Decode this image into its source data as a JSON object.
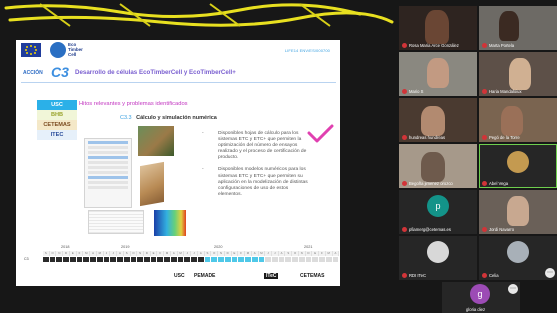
{
  "slide": {
    "top_label": "LIFE14 ENV/ES/000700",
    "logo_text": [
      "Eco",
      "Timber",
      "Cell"
    ],
    "action_word": "ACCIÓN",
    "action_code": "C3",
    "action_title": "Desarrollo de células EcoTimberCell y EcoTimberCell+",
    "partners": [
      "USC",
      "BHB",
      "CETEMAS",
      "ITEC"
    ],
    "hitos_title": "Hitos relevantes y problemas identificados",
    "sub_number": "C3.3",
    "sub_title": "Cálculo y simulación numérica",
    "bullets": [
      "Disponibles hojas de cálculo para los sistemas ETC y ETC+ que permiten la optimización del número de ensayos realizado y el proceso de certificación de producto.",
      "Disponibles modelos numéricos para los sistemas ETC y ETC+ que permiten su aplicación en la modelización de distintas configuraciones de uso de estos elementos."
    ],
    "bullet_dash": "-",
    "timeline": {
      "years": [
        "2018",
        "2019",
        "2020",
        "2021"
      ],
      "months": [
        "S",
        "O",
        "N",
        "D",
        "E",
        "F",
        "M",
        "A",
        "M",
        "J",
        "J",
        "A",
        "S",
        "O",
        "N",
        "D",
        "E",
        "F",
        "M",
        "A",
        "M",
        "J",
        "J",
        "A",
        "S",
        "O",
        "N",
        "D",
        "E",
        "F",
        "M",
        "A",
        "M",
        "J",
        "J",
        "A",
        "S",
        "O",
        "N",
        "D",
        "E",
        "F",
        "M",
        "A"
      ],
      "row_label": "C3"
    },
    "logos": [
      "USC",
      "PEMADE",
      "ITeC",
      "CETEMAS"
    ]
  },
  "participants": [
    {
      "name": "Rosa Maria Arce González",
      "initial": ""
    },
    {
      "name": "Marta Portela",
      "initial": ""
    },
    {
      "name": "Mario S",
      "initial": ""
    },
    {
      "name": "Haria Mandaloiux",
      "initial": ""
    },
    {
      "name": "hundreas hundreas",
      "initial": ""
    },
    {
      "name": "Pegó de la Torre",
      "initial": ""
    },
    {
      "name": "Begoña jimenez orozco",
      "initial": ""
    },
    {
      "name": "Abel Vega",
      "initial": ""
    },
    {
      "name": "pfiamerg@cetemas.es",
      "initial": "p"
    },
    {
      "name": "Jordi Navarro",
      "initial": ""
    },
    {
      "name": "RDI ITeC",
      "initial": ""
    },
    {
      "name": "Celia",
      "initial": ""
    },
    {
      "name": "gloria diez",
      "initial": "g"
    }
  ],
  "colors": {
    "timeline_active": "#4fc8e8",
    "timeline_done": "#2a2a2a",
    "check": "#e040b0",
    "avatar_teal": "#139389",
    "avatar_purple": "#9c4bb5"
  }
}
